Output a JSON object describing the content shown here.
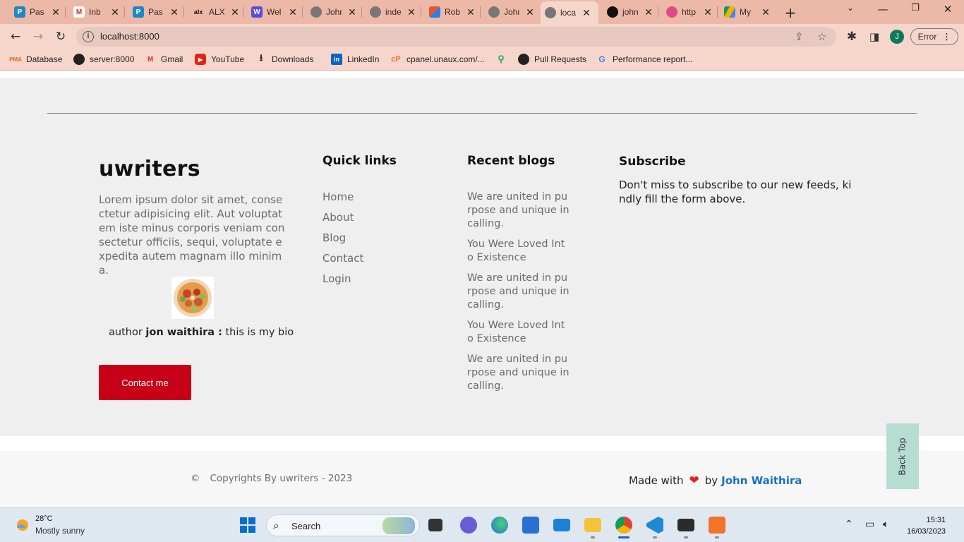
{
  "browser": {
    "tabs": [
      {
        "title": "Pas",
        "icon": "paypal-icon",
        "color": "#1e88c7",
        "glyph": "P"
      },
      {
        "title": "Inb",
        "icon": "gmail-icon",
        "color": "#d93025",
        "glyph": "M"
      },
      {
        "title": "Pas",
        "icon": "paypal-icon",
        "color": "#1e88c7",
        "glyph": "P"
      },
      {
        "title": "ALX",
        "icon": "alx-icon",
        "color": "#111111",
        "glyph": "alx"
      },
      {
        "title": "Wel",
        "icon": "w-icon",
        "color": "#5b4be0",
        "glyph": "W"
      },
      {
        "title": "John",
        "icon": "globe-icon",
        "color": "#666666",
        "glyph": "◍"
      },
      {
        "title": "inde",
        "icon": "globe-icon",
        "color": "#666666",
        "glyph": "◍"
      },
      {
        "title": "Rob",
        "icon": "colorful-icon",
        "color": "#e8552b",
        "glyph": "▦"
      },
      {
        "title": "John",
        "icon": "globe-icon",
        "color": "#666666",
        "glyph": "◍"
      },
      {
        "title": "loca",
        "icon": "globe-icon",
        "color": "#666666",
        "glyph": "◍",
        "active": true
      },
      {
        "title": "john",
        "icon": "github-icon",
        "color": "#111111",
        "glyph": "●"
      },
      {
        "title": "http",
        "icon": "dribbble-icon",
        "color": "#e24a85",
        "glyph": "◉"
      },
      {
        "title": "My",
        "icon": "drive-icon",
        "color": "#f4b400",
        "glyph": "▲"
      }
    ],
    "url": "localhost:8000",
    "profile_initial": "J",
    "error_label": "Error",
    "bookmarks": [
      {
        "label": "Database",
        "icon": "phpmyadmin-icon"
      },
      {
        "label": "server:8000",
        "icon": "globe-icon"
      },
      {
        "label": "Gmail",
        "icon": "gmail-icon"
      },
      {
        "label": "YouTube",
        "icon": "youtube-icon"
      },
      {
        "label": "Downloads",
        "icon": "download-icon"
      },
      {
        "label": "LinkedIn",
        "icon": "linkedin-icon"
      },
      {
        "label": "cpanel.unaux.com/...",
        "icon": "cpanel-icon"
      },
      {
        "label": "",
        "icon": "maps-icon"
      },
      {
        "label": "Pull Requests",
        "icon": "github-icon"
      },
      {
        "label": "Performance report...",
        "icon": "google-icon"
      }
    ]
  },
  "footer": {
    "brand": "uwriters",
    "description": "Lorem ipsum dolor sit amet, consectetur adipisicing elit. Aut voluptatem iste minus corporis veniam consectetur officiis, sequi, voluptate expedita autem magnam illo minima.",
    "author_prefix": "author",
    "author_name": "jon waithira :",
    "author_bio": "this is my bio",
    "contact_label": "Contact me",
    "quick_links_title": "Quick links",
    "quick_links": [
      "Home",
      "About",
      "Blog",
      "Contact",
      "Login"
    ],
    "recent_blogs_title": "Recent blogs",
    "recent_blogs": [
      "We are united in purpose and unique in calling.",
      "You Were Loved Into Existence",
      "We are united in purpose and unique in calling.",
      "You Were Loved Into Existence",
      "We are united in purpose and unique in calling."
    ],
    "subscribe_title": "Subscribe",
    "subscribe_text": "Don't miss to subscribe to our new feeds, kindly fill the form above.",
    "copyright_symbol": "©",
    "copyright": "Copyrights By uwriters - 2023",
    "made_with": "Made with",
    "by": "by",
    "made_by": "John Waithira",
    "back_top": "Back Top"
  },
  "taskbar": {
    "temperature": "28°C",
    "condition": "Mostly sunny",
    "search_placeholder": "Search",
    "time": "15:31",
    "date": "16/03/2023"
  },
  "colors": {
    "accent_red": "#c80017",
    "link_blue": "#1a6fc4",
    "tabstrip": "#ecb9a8",
    "back_top_bg": "#b6ddd2"
  }
}
